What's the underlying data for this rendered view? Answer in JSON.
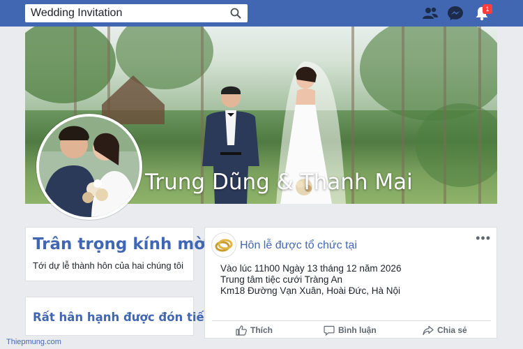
{
  "topbar": {
    "search_value": "Wedding Invitation",
    "notification_count": "1",
    "brand_color": "#4267b2",
    "icons": [
      "search-icon",
      "friends-icon",
      "messenger-icon",
      "notification-bell-icon"
    ]
  },
  "cover": {
    "name": "Trung Dũng & Thanh Mai"
  },
  "left": {
    "card1_title": "Trân trọng kính mời",
    "card1_subtitle": "Tới dự lễ thành hôn của hai chúng tôi",
    "card2_title": "Rất hân hạnh được đón tiếp"
  },
  "post": {
    "title": "Hôn lễ được tổ chức tại",
    "more": "•••",
    "line1": "Vào lúc 11h00 Ngày 13 tháng 12 năm 2026",
    "line2": "Trung tâm tiệc cưới Tràng An",
    "line3": "Km18 Đường Vạn Xuân, Hoài Đức, Hà Nội",
    "actions": {
      "like": "Thích",
      "comment": "Bình luận",
      "share": "Chia sẻ"
    }
  },
  "footer": {
    "brand": "Thiepmung.com"
  }
}
